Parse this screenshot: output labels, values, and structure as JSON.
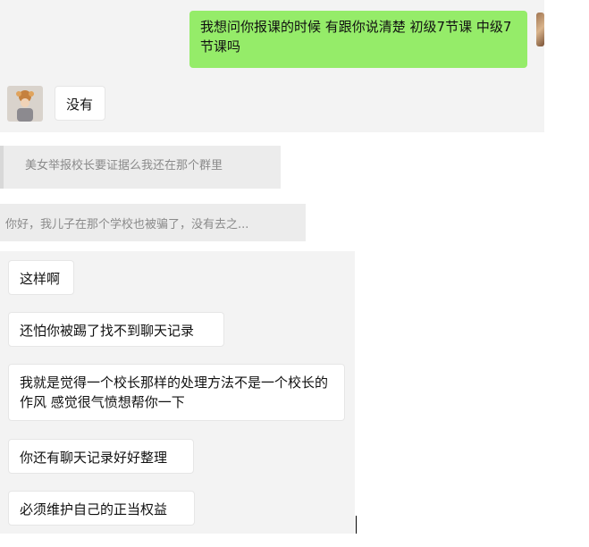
{
  "chat_top": {
    "sent_message": "我想问你报课的时候  有跟你说清楚 初级7节课 中级7节课吗",
    "reply": "没有"
  },
  "quotes": {
    "first": "美女举报校长要证据么我还在那个群里",
    "second": "你好，我儿子在那个学校也被骗了，没有去之..."
  },
  "chat_bottom": {
    "messages": [
      "这样啊",
      "还怕你被踢了找不到聊天记录",
      "我就是觉得一个校长那样的处理方法不是一个校长的作风 感觉很气愤想帮你一下",
      "你还有聊天记录好好整理",
      "必须维护自己的正当权益"
    ]
  },
  "colors": {
    "sent_bubble": "#95ec69",
    "received_bubble": "#ffffff",
    "panel_background": "#f3f3f3"
  }
}
